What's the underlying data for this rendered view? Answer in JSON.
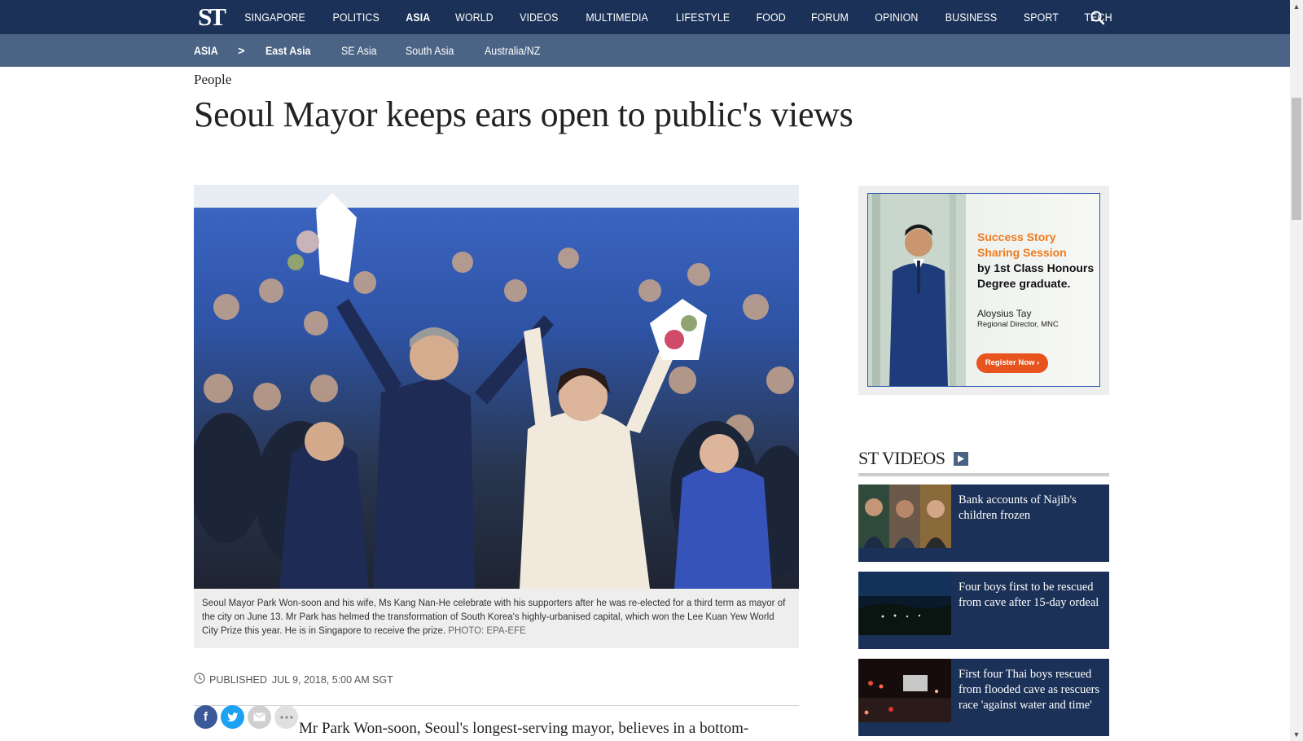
{
  "logo": "ST",
  "nav": {
    "items": [
      "SINGAPORE",
      "POLITICS",
      "ASIA",
      "WORLD",
      "VIDEOS",
      "MULTIMEDIA",
      "LIFESTYLE",
      "FOOD",
      "FORUM",
      "OPINION",
      "BUSINESS",
      "SPORT",
      "TECH"
    ],
    "active": "ASIA"
  },
  "subnav": {
    "section": "ASIA",
    "separator": ">",
    "items": [
      "East Asia",
      "SE Asia",
      "South Asia",
      "Australia/NZ"
    ],
    "current": "East Asia"
  },
  "article": {
    "kicker": "People",
    "headline": "Seoul Mayor keeps ears open to public's views",
    "caption": "Seoul Mayor Park Won-soon and his wife, Ms Kang Nan-He celebrate with his supporters after he was re-elected for a third term as mayor of the city on June 13. Mr Park has helmed the transformation of South Korea's highly-urbanised capital, which won the Lee Kuan Yew World City Prize this year. He is in Singapore to receive the prize.",
    "photo_credit": "PHOTO: EPA-EFE",
    "published_label": "PUBLISHED",
    "published_date": "JUL 9, 2018, 5:00 AM SGT",
    "lede": "Mr Park Won-soon, Seoul's longest-serving mayor, believes in a bottom-"
  },
  "share": {
    "facebook": "f",
    "twitter": "t",
    "email": "email",
    "more": "more"
  },
  "ad": {
    "title_line1": "Success Story",
    "title_line2": "Sharing Session",
    "sub_line1": "by 1st Class Honours",
    "sub_line2": "Degree graduate.",
    "name": "Aloysius Tay",
    "role": "Regional Director, MNC",
    "cta": "Register Now ›"
  },
  "videos": {
    "title": "ST VIDEOS",
    "items": [
      {
        "title": "Bank accounts of Najib's children frozen"
      },
      {
        "title": "Four boys first to be rescued from cave after 15-day ordeal"
      },
      {
        "title": "First four Thai boys rescued from flooded cave as rescuers race 'against water and time'"
      }
    ]
  },
  "colors": {
    "nav_bg": "#1b3157",
    "subnav_bg": "#4b6384",
    "card_bg": "#1b3157",
    "ad_accent": "#f07a1e"
  }
}
